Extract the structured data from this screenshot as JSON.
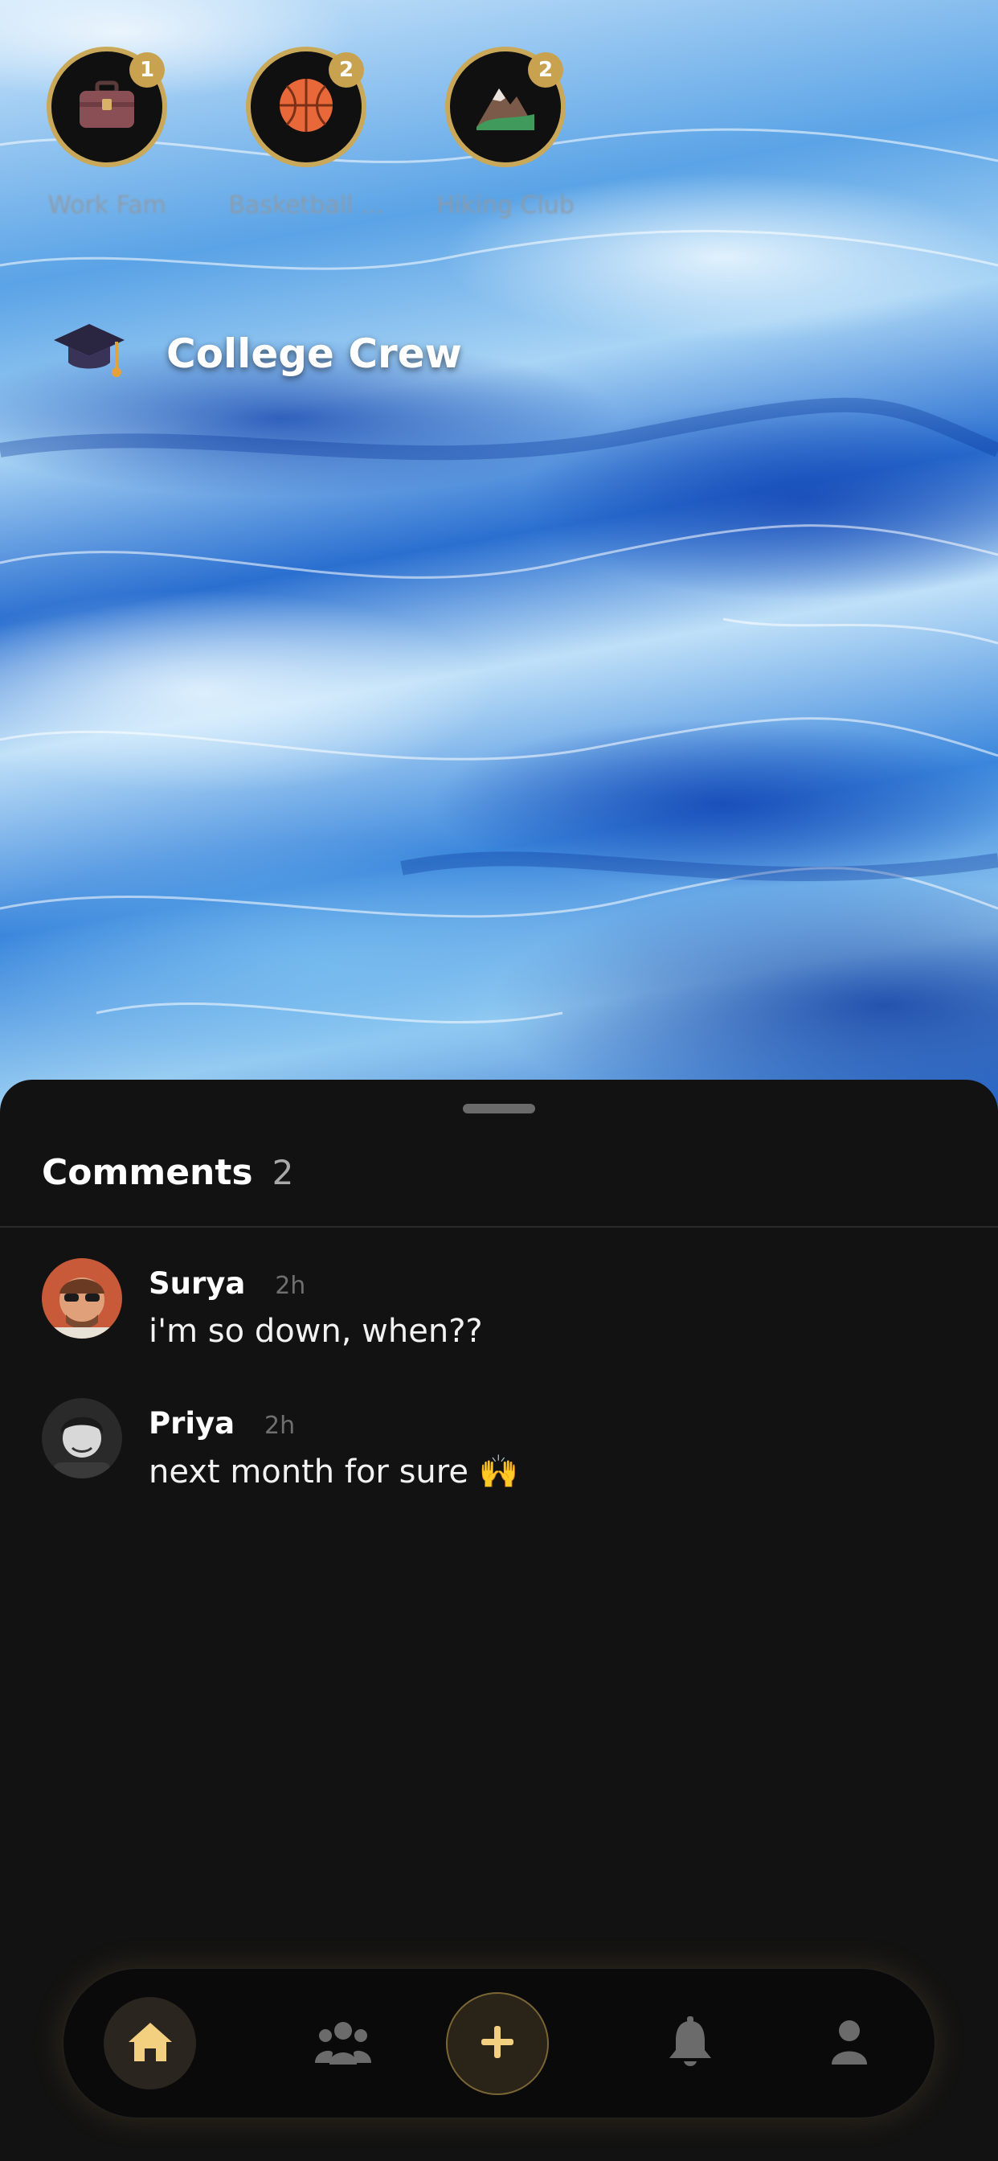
{
  "stories": [
    {
      "label": "Work Fam",
      "badge": "1",
      "icon": "briefcase-icon"
    },
    {
      "label": "Basketball ...",
      "badge": "2",
      "icon": "basketball-icon"
    },
    {
      "label": "Hiking Club",
      "badge": "2",
      "icon": "mountain-icon"
    }
  ],
  "group": {
    "name": "College Crew",
    "icon": "graduation-cap-icon"
  },
  "comments_panel": {
    "title": "Comments",
    "count": "2",
    "items": [
      {
        "name": "Surya",
        "time": "2h",
        "text": "i'm so down, when??"
      },
      {
        "name": "Priya",
        "time": "2h",
        "text": "next month for sure 🙌"
      }
    ]
  },
  "nav": {
    "items": [
      "home-icon",
      "groups-icon",
      "plus-icon",
      "bell-icon",
      "profile-icon"
    ],
    "active": "home-icon"
  },
  "colors": {
    "accent_gold": "#c9a24f",
    "sheet_bg": "#121212",
    "active_icon": "#f3cf80",
    "inactive_icon": "#6b6b6b"
  }
}
